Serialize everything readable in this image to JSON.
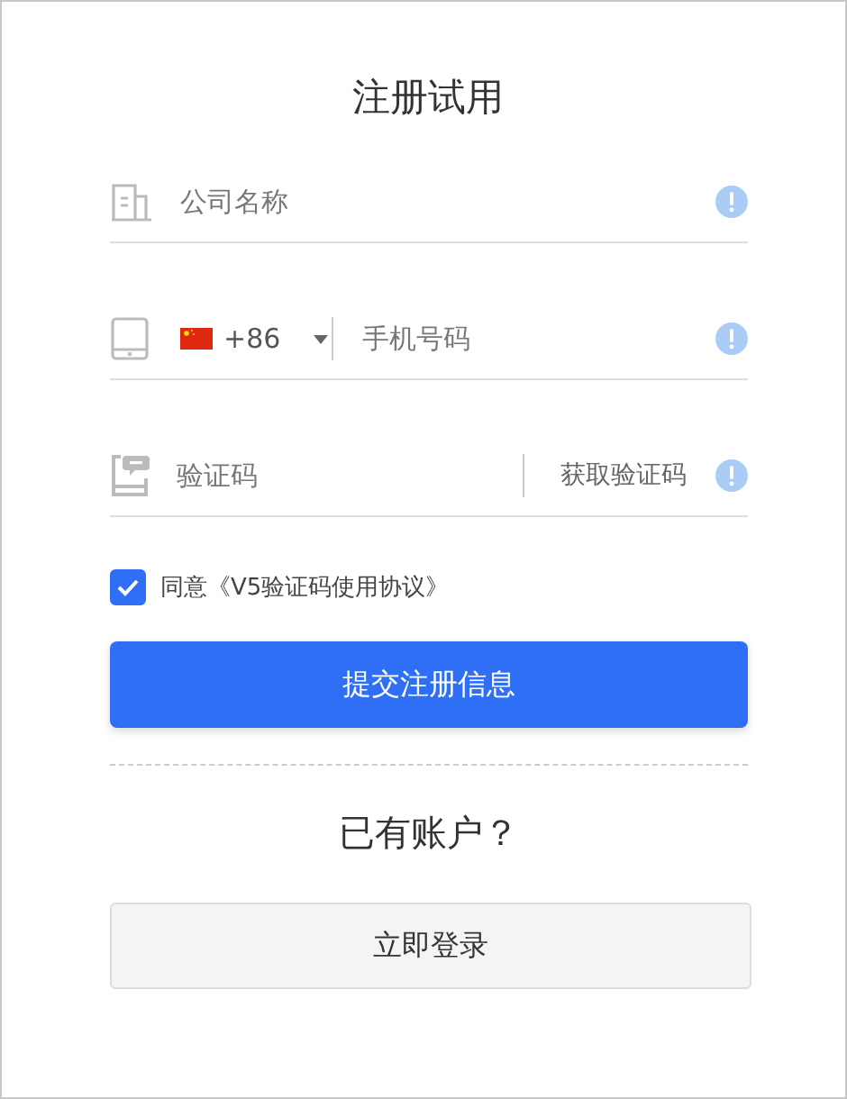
{
  "title": "注册试用",
  "fields": [
    {
      "kind": "company",
      "placeholder": "公司名称"
    },
    {
      "kind": "phone",
      "country_code": "+86",
      "placeholder": "手机号码"
    },
    {
      "kind": "code",
      "placeholder": "验证码",
      "action": "获取验证码"
    }
  ],
  "agreement": {
    "checked": true,
    "text": "同意《V5验证码使用协议》"
  },
  "submit": "提交注册信息",
  "login_prompt": "已有账户？",
  "login": "立即登录"
}
